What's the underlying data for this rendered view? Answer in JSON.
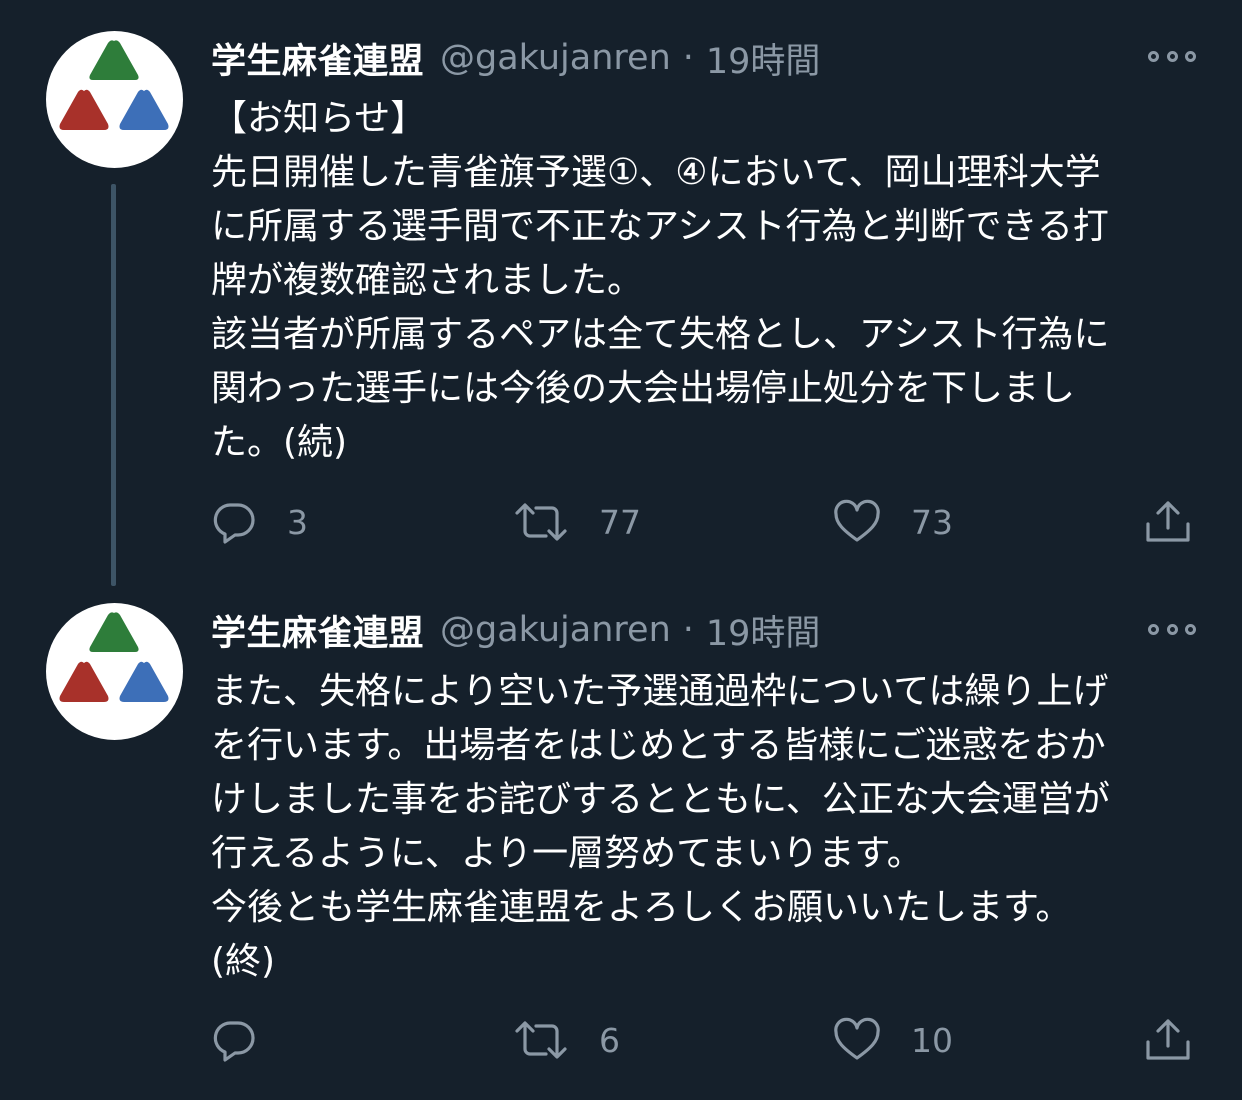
{
  "tweets": [
    {
      "display_name": "学生麻雀連盟",
      "handle": "@gakujanren",
      "separator": "·",
      "time": "19時間",
      "text_lines": [
        "【お知らせ】",
        "先日開催した青雀旗予選①、④において、岡山理科大学",
        "に所属する選手間で不正なアシスト行為と判断できる打",
        "牌が複数確認されました。",
        "該当者が所属するペアは全て失格とし、アシスト行為に",
        "関わった選手には今後の大会出場停止処分を下しまし",
        "た。(続)"
      ],
      "actions": {
        "reply_count": "3",
        "retweet_count": "77",
        "like_count": "73"
      }
    },
    {
      "display_name": "学生麻雀連盟",
      "handle": "@gakujanren",
      "separator": "·",
      "time": "19時間",
      "text_lines": [
        "また、失格により空いた予選通過枠については繰り上げ",
        "を行います。出場者をはじめとする皆様にご迷惑をおか",
        "けしました事をお詫びするとともに、公正な大会運営が",
        "行えるように、より一層努めてまいります。",
        "今後とも学生麻雀連盟をよろしくお願いいたします。",
        "(終)"
      ],
      "actions": {
        "reply_count": "",
        "retweet_count": "6",
        "like_count": "10"
      }
    }
  ],
  "colors": {
    "background": "#15202b",
    "secondary_text": "#8b98a5",
    "thread_line": "#3d5466",
    "logo_green": "#2e7d3a",
    "logo_red": "#a8312a",
    "logo_blue": "#3d6fb8"
  },
  "icons": {
    "reply": "reply-icon",
    "retweet": "retweet-icon",
    "like": "heart-icon",
    "share": "share-icon",
    "more": "more-icon"
  }
}
